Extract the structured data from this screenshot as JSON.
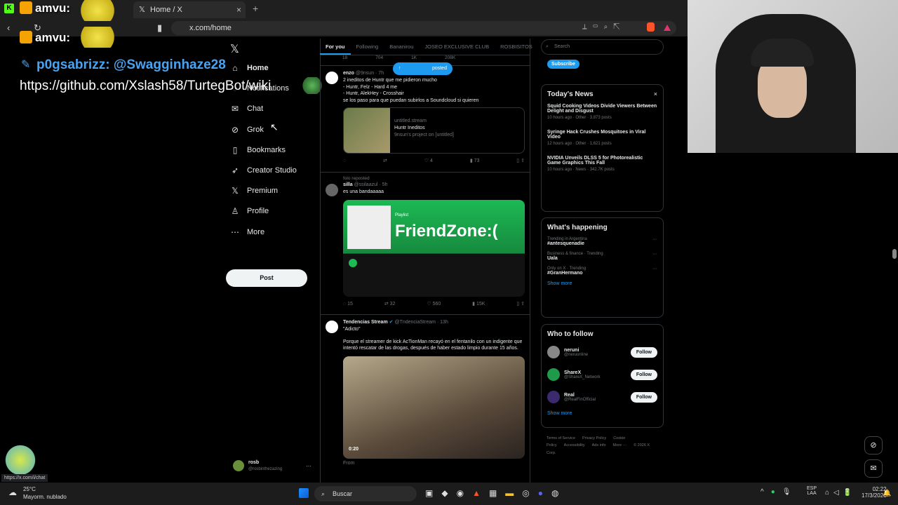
{
  "browser": {
    "tab_title": "Home / X",
    "new_tab": "+",
    "close_tab": "×",
    "url": "x.com/home"
  },
  "overlay": {
    "line1": "amvu:",
    "line2": "amvu:",
    "line3": "p0gsabrizz: @Swagginhaze28",
    "line4": "https://github.com/Xslash58/TurtegBot/wiki",
    "status_url": "https://x.com/i/chat"
  },
  "nav": {
    "items": [
      {
        "label": "Home",
        "icon": "home-icon"
      },
      {
        "label": "Notifications",
        "icon": "bell-icon"
      },
      {
        "label": "Chat",
        "icon": "mail-icon"
      },
      {
        "label": "Grok",
        "icon": "grok-icon"
      },
      {
        "label": "Bookmarks",
        "icon": "bookmark-icon"
      },
      {
        "label": "Creator Studio",
        "icon": "rocket-icon"
      },
      {
        "label": "Premium",
        "icon": "x-icon"
      },
      {
        "label": "Profile",
        "icon": "person-icon"
      },
      {
        "label": "More",
        "icon": "more-icon"
      }
    ],
    "post_label": "Post",
    "account_name": "rosb",
    "account_handle": "@rosbinthezazing"
  },
  "feed": {
    "tabs": [
      "For you",
      "Following",
      "Bananirou",
      "JOSEO EXCLUSIVE CLUB",
      "ROSBISITOS"
    ],
    "posted_pill": "posted",
    "top_stats": [
      "18",
      "704",
      "1K",
      "208K"
    ],
    "tweets": [
      {
        "name": "enzo",
        "handle": "@9nsun · 7h",
        "text_lines": [
          "2 ineditos de Huntr que me pidieron mucho",
          "- Huntr, Felz - Hard 4 me",
          "- Huntr, AlekHey - Crosshair",
          "se los paso para que puedan subirlos a Soundcloud si quieren"
        ],
        "card_domain": "untitled.stream",
        "card_title": "Huntr Ineditos",
        "card_sub": "9nsun's project on [untitled]",
        "stats": [
          "",
          "",
          "4",
          "73"
        ]
      },
      {
        "reposted_by": "folo reposted",
        "name": "silla",
        "handle": "@ssilaazul · 5h",
        "text_lines": [
          "es una bandaaaaa"
        ],
        "media_title": "FriendZone:(",
        "media_sub": "Playlist",
        "stats": [
          "15",
          "32",
          "560",
          "15K"
        ]
      },
      {
        "name": "Tendencias Stream",
        "handle": "@TndenciaStream · 13h",
        "text_lines": [
          "\"Adicto\"",
          "",
          "Porque el streamer de kick AcTionMan recayó en el fentanilo con un indigente que intentó rescatar de las drogas, después de haber estado limpio durante 15 años."
        ],
        "video_time": "0:20",
        "from_label": "From"
      }
    ]
  },
  "right": {
    "search_placeholder": "Search",
    "subscribe_label": "Subscribe",
    "news_title": "Today's News",
    "news": [
      {
        "title": "Squid Cooking Videos Divide Viewers Between Delight and Disgust",
        "meta": "10 hours ago · Other · 3,873 posts"
      },
      {
        "title": "Syringe Hack Crushes Mosquitoes in Viral Video",
        "meta": "12 hours ago · Other · 1,621 posts"
      },
      {
        "title": "NVIDIA Unveils DLSS 5 for Photorealistic Game Graphics This Fall",
        "meta": "10 hours ago · News · 342.7K posts"
      }
    ],
    "happening_title": "What's happening",
    "trends": [
      {
        "context": "Trending in Argentina",
        "name": "#antesquenadie"
      },
      {
        "context": "Business & finance · Trending",
        "name": "Uala"
      },
      {
        "context": "Only on X · Trending",
        "name": "#GranHermano"
      }
    ],
    "show_more": "Show more",
    "follow_title": "Who to follow",
    "follow": [
      {
        "name": "neruni",
        "handle": "@neruonline",
        "color": "#888888"
      },
      {
        "name": "ShareX",
        "handle": "@ShareX_Network",
        "color": "#1e9a4a"
      },
      {
        "name": "Real",
        "handle": "@RealFinOfficial",
        "color": "#3b2a6e"
      }
    ],
    "follow_label": "Follow",
    "footer": [
      "Terms of Service",
      "Privacy Policy",
      "Cookie Policy",
      "Accessibility",
      "Ads info",
      "More ···",
      "© 2026 X Corp."
    ]
  },
  "taskbar": {
    "weather_temp": "25°C",
    "weather_desc": "Mayorm. nublado",
    "search_label": "Buscar",
    "lang": "ESP",
    "lang2": "LAA",
    "time": "02:22",
    "date": "17/3/2026"
  },
  "colors": {
    "accent": "#1d9bf0",
    "spotify_green": "#1db954"
  }
}
